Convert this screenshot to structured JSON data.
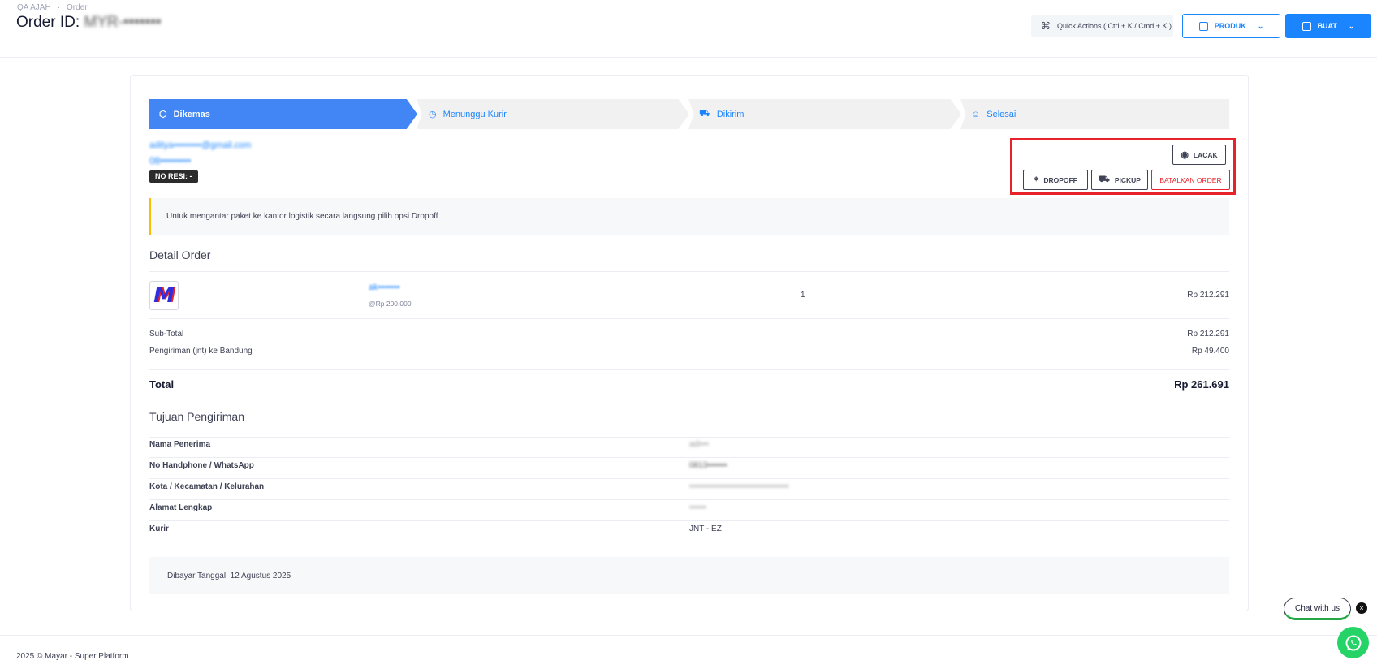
{
  "header": {
    "breadcrumb": [
      "QA AJAH",
      "Order"
    ],
    "title_prefix": "Order ID: ",
    "title_id": "MYR-•••••••",
    "quick_actions": "Quick Actions ( Ctrl + K / Cmd + K )",
    "produk_label": "PRODUK",
    "buat_label": "BUAT"
  },
  "steps": [
    {
      "label": "Dikemas",
      "icon": "box-icon"
    },
    {
      "label": "Menunggu Kurir",
      "icon": "clock-icon"
    },
    {
      "label": "Dikirim",
      "icon": "truck-icon"
    },
    {
      "label": "Selesai",
      "icon": "smile-icon"
    }
  ],
  "customer": {
    "email": "aditya•••••••••@gmail.com",
    "phone": "08•••••••••",
    "resi": "NO RESI: -"
  },
  "actions": {
    "lacak": "LACAK",
    "dropoff": "DROPOFF",
    "pickup": "PICKUP",
    "batal": "BATALKAN ORDER"
  },
  "notice": "Untuk mengantar paket ke kantor logistik secara langsung pilih opsi Dropoff",
  "detail": {
    "title": "Detail Order",
    "product": {
      "name": "ak•••••••",
      "unit_price": "@Rp 200.000",
      "qty": "1",
      "total": "Rp 212.291"
    },
    "subtotal_label": "Sub-Total",
    "subtotal_value": "Rp 212.291",
    "shipping_label": "Pengiriman (jnt) ke Bandung",
    "shipping_value": "Rp 49.400",
    "total_label": "Total",
    "total_value": "Rp 261.691"
  },
  "destination": {
    "title": "Tujuan Pengiriman",
    "rows": [
      {
        "label": "Nama Penerima",
        "value": "adi•••"
      },
      {
        "label": "No Handphone / WhatsApp",
        "value": "0813•••••••"
      },
      {
        "label": "Kota / Kecamatan / Kelurahan",
        "value": "•••••••••••••••••••••••••••••••••••"
      },
      {
        "label": "Alamat Lengkap",
        "value": "••••••"
      },
      {
        "label": "Kurir",
        "value": "JNT - EZ"
      }
    ]
  },
  "paid": "Dibayar Tanggal: 12 Agustus 2025",
  "footer": "2025 © Mayar - Super Platform",
  "chat": {
    "label": "Chat with us",
    "close": "×"
  }
}
